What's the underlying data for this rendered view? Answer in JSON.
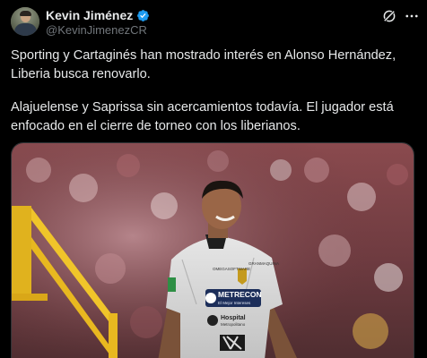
{
  "author": {
    "name": "Kevin Jiménez",
    "handle": "@KevinJimenezCR",
    "verified": true
  },
  "icons": {
    "verified": "verified-badge-icon",
    "grok": "grok-icon",
    "more": "more-options-icon"
  },
  "tweet": {
    "paragraph_1": "Sporting y Cartaginés han mostrado interés en Alonso Hernández, Liberia busca renovarlo.",
    "paragraph_2": "Alajuelense y Saprissa sin acercamientos todavía. El jugador está enfocado en el cierre de torneo con los liberianos."
  },
  "media": {
    "jersey_sponsor_1": "METRECON",
    "jersey_sponsor_1_sub": "El Mejor Intereses",
    "jersey_sponsor_2": "Hospital",
    "jersey_sponsor_2_sub": "Metropolitano",
    "jersey_small_left": "OMEGASOFTWARE",
    "jersey_small_right": "GRANMAQUINA"
  },
  "colors": {
    "background": "#000000",
    "text": "#e7e9ea",
    "secondary": "#71767b",
    "verified": "#1d9bf0"
  }
}
